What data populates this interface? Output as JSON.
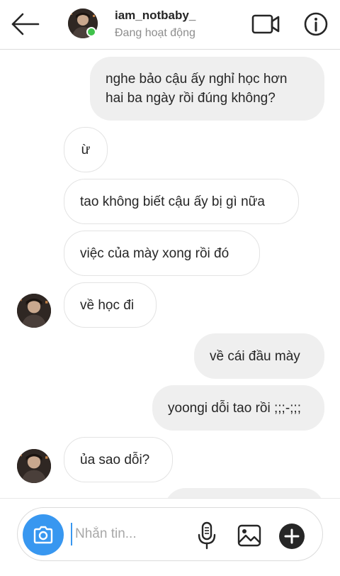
{
  "header": {
    "username": "iam_notbaby_",
    "status": "Đang hoạt động",
    "icons": {
      "back": "arrow-left-icon",
      "video": "video-camera-icon",
      "info": "info-icon"
    },
    "online_color": "#3fc24b"
  },
  "messages": [
    {
      "sender": "me",
      "text": "nghe bảo cậu ấy nghỉ học hơn\nhai ba ngày rồi đúng không?"
    },
    {
      "sender": "them",
      "text": "ừ"
    },
    {
      "sender": "them",
      "text": "tao không biết cậu ấy bị gì nữa"
    },
    {
      "sender": "them",
      "text": "việc của mày xong rồi đó"
    },
    {
      "sender": "them",
      "text": "về học đi"
    },
    {
      "sender": "me",
      "text": "về cái đầu mày"
    },
    {
      "sender": "me",
      "text": "yoongi dỗi tao rồi ;;;-;;;"
    },
    {
      "sender": "them",
      "text": "ủa sao dỗi?"
    }
  ],
  "composer": {
    "placeholder": "Nhắn tin...",
    "icons": [
      "camera-icon",
      "microphone-icon",
      "image-icon",
      "plus-icon"
    ],
    "accent": "#3897f0"
  },
  "colors": {
    "outgoing_bubble": "#efefef",
    "incoming_border": "#e3e3e3",
    "muted_text": "#8e8e8e"
  }
}
